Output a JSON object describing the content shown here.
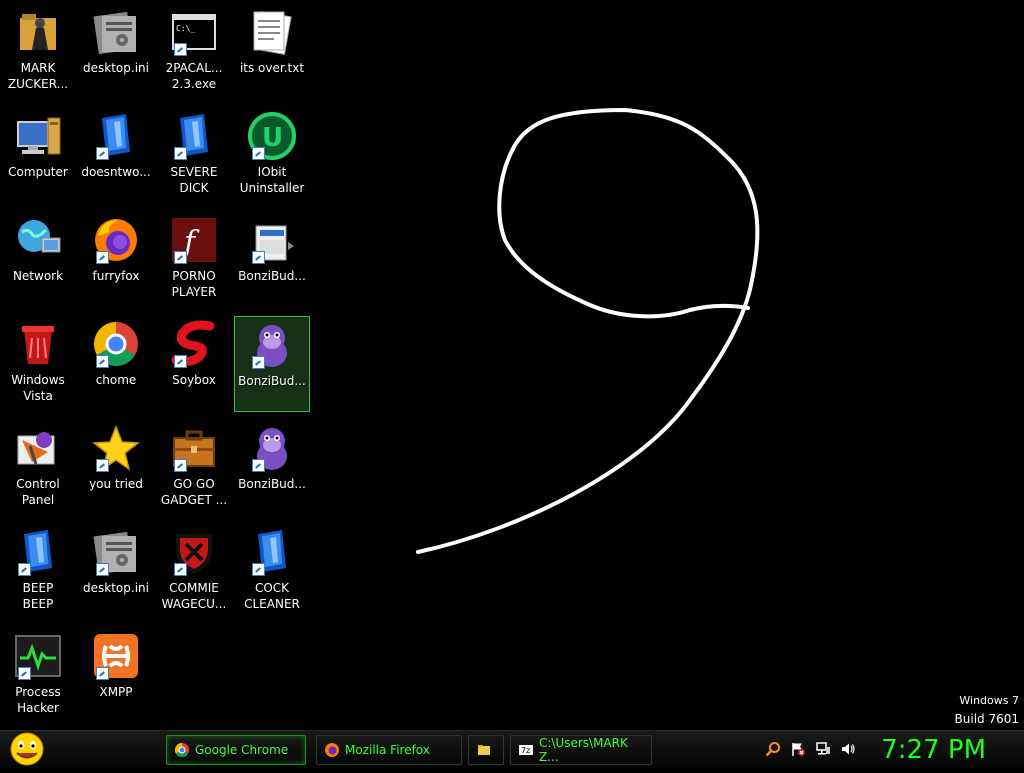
{
  "desktop": {
    "icons": [
      {
        "label": "MARK\nZUCKER...",
        "icon": "folder-person-icon"
      },
      {
        "label": "desktop.ini",
        "icon": "settings-file-icon"
      },
      {
        "label": "2PACAL...\n2.3.exe",
        "icon": "console-exe-icon"
      },
      {
        "label": "its over.txt",
        "icon": "text-file-icon"
      },
      {
        "label": "Computer",
        "icon": "computer-icon"
      },
      {
        "label": "doesntwo...",
        "icon": "blue-app-icon"
      },
      {
        "label": "SEVERE\nDICK",
        "icon": "blue-app-icon"
      },
      {
        "label": "IObit\nUninstaller",
        "icon": "iobit-uninstaller-icon"
      },
      {
        "label": "Network",
        "icon": "network-globe-icon"
      },
      {
        "label": "furryfox",
        "icon": "firefox-icon"
      },
      {
        "label": "PORNO\nPLAYER",
        "icon": "flash-player-icon"
      },
      {
        "label": "BonziBud...",
        "icon": "bonzi-folder-icon"
      },
      {
        "label": "Windows\nVista",
        "icon": "recycle-bin-icon"
      },
      {
        "label": "chome",
        "icon": "chrome-icon"
      },
      {
        "label": "Soybox",
        "icon": "soybox-icon"
      },
      {
        "label": "BonziBud...",
        "icon": "bonzi-gorilla-icon",
        "selected": true
      },
      {
        "label": "Control\nPanel",
        "icon": "control-panel-icon"
      },
      {
        "label": "you tried",
        "icon": "star-icon"
      },
      {
        "label": "GO GO\nGADGET ...",
        "icon": "briefcase-icon"
      },
      {
        "label": "BonziBud...",
        "icon": "bonzi-gorilla-icon"
      },
      {
        "label": "BEEP\nBEEP",
        "icon": "blue-app-icon"
      },
      {
        "label": "desktop.ini",
        "icon": "settings-file-icon"
      },
      {
        "label": "COMMIE\nWAGECU...",
        "icon": "commie-shield-icon"
      },
      {
        "label": "COCK\nCLEANER",
        "icon": "blue-app-icon"
      },
      {
        "label": "Process\nHacker",
        "icon": "process-hacker-icon"
      },
      {
        "label": "XMPP",
        "icon": "xampp-icon"
      }
    ]
  },
  "watermark": {
    "line1": "Windows 7",
    "line2": "Build 7601"
  },
  "taskbar": {
    "tasks": [
      {
        "label": "Google Chrome",
        "icon": "chrome-icon",
        "active": true
      },
      {
        "label": "Mozilla Firefox",
        "icon": "firefox-icon",
        "active": false
      },
      {
        "label": "",
        "icon": "explorer-folder-icon",
        "active": false
      },
      {
        "label": "C:\\Users\\MARK Z...",
        "icon": "7zip-icon",
        "active": false
      }
    ],
    "tray": [
      "search-icon",
      "action-center-flag-icon",
      "network-tray-icon",
      "volume-icon"
    ],
    "clock": "7:27 PM"
  },
  "colors": {
    "taskbar_text": "#3cff3c",
    "clock": "#1aff1a",
    "selection_border": "#3cba3c"
  }
}
